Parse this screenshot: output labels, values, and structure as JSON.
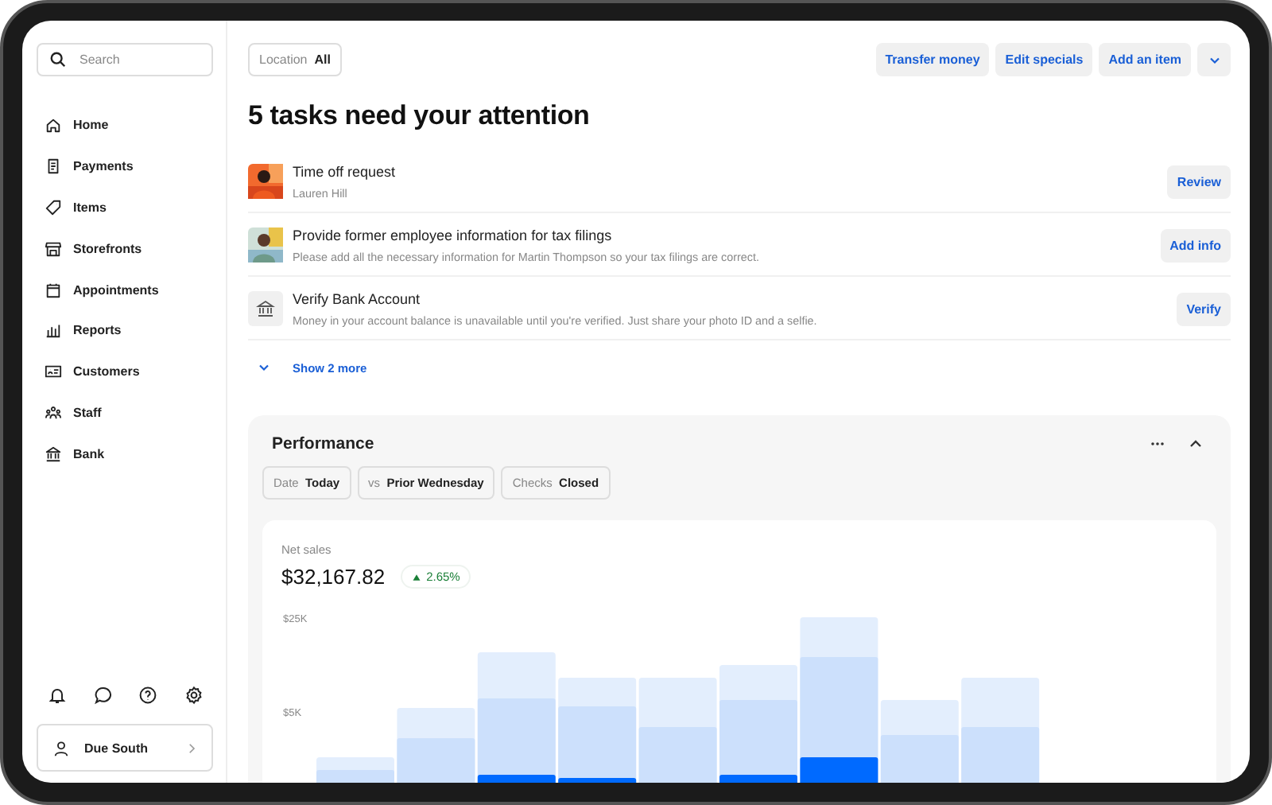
{
  "sidebar": {
    "search": {
      "placeholder": "Search"
    },
    "nav": [
      {
        "label": "Home"
      },
      {
        "label": "Payments"
      },
      {
        "label": "Items"
      },
      {
        "label": "Storefronts"
      },
      {
        "label": "Appointments"
      },
      {
        "label": "Reports"
      },
      {
        "label": "Customers"
      },
      {
        "label": "Staff"
      },
      {
        "label": "Bank"
      }
    ],
    "account": {
      "name": "Due South"
    }
  },
  "toolbar": {
    "location": {
      "label": "Location",
      "value": "All"
    },
    "actions": [
      "Transfer money",
      "Edit specials",
      "Add an item"
    ]
  },
  "heading": "5 tasks need your attention",
  "tasks": [
    {
      "title": "Time off request",
      "subtitle": "Lauren Hill",
      "action": "Review"
    },
    {
      "title": "Provide former employee information for tax filings",
      "subtitle": "Please add all the necessary information for Martin Thompson so your tax filings are correct.",
      "action": "Add info"
    },
    {
      "kind": "bank",
      "title": "Verify Bank Account",
      "subtitle": "Money in your account balance is unavailable until you're verified. Just share your photo ID and a selfie.",
      "action": "Verify"
    }
  ],
  "show_more": "Show 2 more",
  "performance": {
    "title": "Performance",
    "filters": [
      {
        "label": "Date",
        "value": "Today"
      },
      {
        "label": "vs",
        "value": "Prior Wednesday"
      },
      {
        "label": "Checks",
        "value": "Closed"
      }
    ],
    "net_sales": {
      "label": "Net sales",
      "amount": "$32,167.82",
      "change": "2.65%"
    },
    "y_labels": [
      "$25K",
      "$5K"
    ]
  }
}
